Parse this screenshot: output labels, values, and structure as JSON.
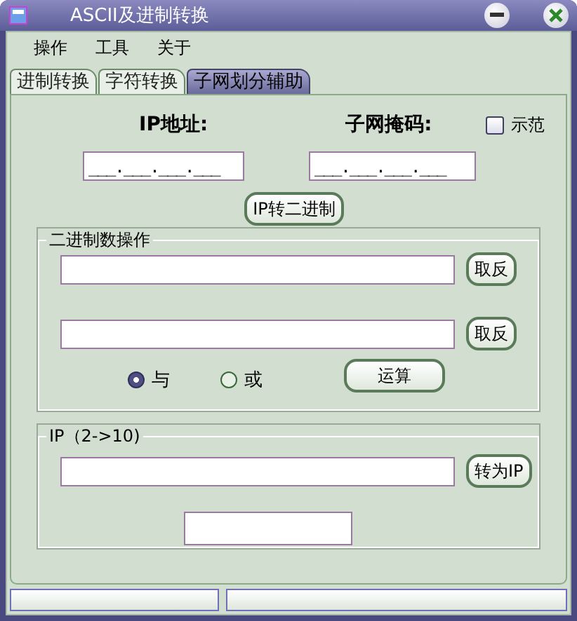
{
  "window": {
    "title": "ASCII及进制转换"
  },
  "menu": [
    "操作",
    "工具",
    "关于"
  ],
  "tabs": [
    {
      "label": "进制转换",
      "selected": false
    },
    {
      "label": "字符转换",
      "selected": false
    },
    {
      "label": "子网划分辅助",
      "selected": true
    }
  ],
  "ip_label": "IP地址:",
  "mask_label": "子网掩码:",
  "demo_checkbox": {
    "label": "示范",
    "checked": false
  },
  "ip_field": {
    "value": "___.___.___.___"
  },
  "mask_field": {
    "value": "___.___.___.___"
  },
  "ip_to_binary_button": "IP转二进制",
  "binary_group": {
    "title": "二进制数操作",
    "invert_buttons": [
      "取反",
      "取反"
    ],
    "operations": [
      {
        "label": "与",
        "selected": true
      },
      {
        "label": "或",
        "selected": false
      }
    ],
    "compute_button": "运算"
  },
  "ip_group": {
    "title": "IP（2->10)",
    "convert_button": "转为IP"
  }
}
